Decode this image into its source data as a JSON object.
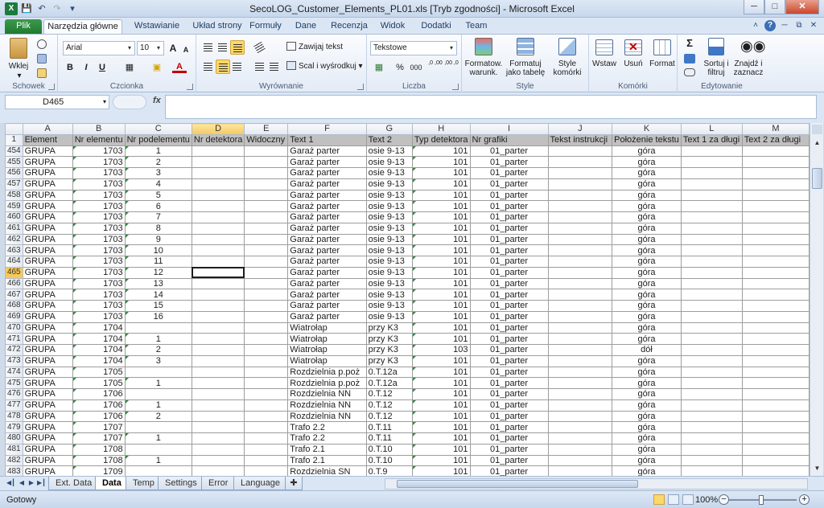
{
  "window": {
    "title": "SecoLOG_Customer_Elements_PL01.xls  [Tryb zgodności]  -  Microsoft Excel",
    "app_icon": "X",
    "quick_access": [
      "save-icon",
      "undo-icon",
      "redo-icon",
      "customize-icon"
    ],
    "controls": [
      "minimize-icon",
      "maximize-icon",
      "close-icon"
    ]
  },
  "ribbon_tabs": [
    "Plik",
    "Narzędzia główne",
    "Wstawianie",
    "Układ strony",
    "Formuły",
    "Dane",
    "Recenzja",
    "Widok",
    "Dodatki",
    "Team"
  ],
  "ribbon": {
    "clipboard": {
      "paste": "Wklej",
      "label": "Schowek"
    },
    "font": {
      "name": "Arial",
      "size": "10",
      "bold": "B",
      "italic": "I",
      "underline": "U",
      "grow": "A",
      "shrink": "A",
      "color": "A",
      "label": "Czcionka"
    },
    "alignment": {
      "wrap": "Zawijaj tekst",
      "merge": "Scal i wyśrodkuj",
      "label": "Wyrównanie"
    },
    "number": {
      "format": "Tekstowe",
      "percent": "%",
      "thousands": "000",
      "inc_dec": ",0 ,00",
      "dec_dec": ",00 ,0",
      "label": "Liczba"
    },
    "styles": {
      "conditional": "Formatow. warunk.",
      "as_table": "Formatuj jako tabelę",
      "cell_styles": "Style komórki",
      "label": "Style"
    },
    "cells": {
      "insert": "Wstaw",
      "delete": "Usuń",
      "format": "Format",
      "label": "Komórki"
    },
    "editing": {
      "sum": "Σ",
      "sort": "Sortuj i filtruj",
      "find": "Znajdź i zaznacz",
      "label": "Edytowanie"
    }
  },
  "formula_bar": {
    "name_box": "D465",
    "fx": "fx",
    "formula": ""
  },
  "grid": {
    "columns": [
      "A",
      "B",
      "C",
      "D",
      "E",
      "F",
      "G",
      "H",
      "I",
      "J",
      "K",
      "L",
      "M"
    ],
    "selected_column": "D",
    "header_row_number": "1",
    "headers": [
      "Element",
      "Nr elementu",
      "Nr podelementu",
      "Nr detektora",
      "Widoczny",
      "Text 1",
      "Text 2",
      "Typ detektora",
      "Nr grafiki",
      "Tekst instrukcji",
      "Położenie tekstu",
      "Text 1 za długi",
      "Text 2 za długi"
    ],
    "selected_row": "465",
    "rows": [
      {
        "num": "454",
        "cells": [
          "GRUPA",
          "1703",
          "1",
          "",
          "",
          "Garaż parter",
          "osie 9-13",
          "101",
          "01_parter",
          "",
          "góra",
          "",
          ""
        ]
      },
      {
        "num": "455",
        "cells": [
          "GRUPA",
          "1703",
          "2",
          "",
          "",
          "Garaż parter",
          "osie 9-13",
          "101",
          "01_parter",
          "",
          "góra",
          "",
          ""
        ]
      },
      {
        "num": "456",
        "cells": [
          "GRUPA",
          "1703",
          "3",
          "",
          "",
          "Garaż parter",
          "osie 9-13",
          "101",
          "01_parter",
          "",
          "góra",
          "",
          ""
        ]
      },
      {
        "num": "457",
        "cells": [
          "GRUPA",
          "1703",
          "4",
          "",
          "",
          "Garaż parter",
          "osie 9-13",
          "101",
          "01_parter",
          "",
          "góra",
          "",
          ""
        ]
      },
      {
        "num": "458",
        "cells": [
          "GRUPA",
          "1703",
          "5",
          "",
          "",
          "Garaż parter",
          "osie 9-13",
          "101",
          "01_parter",
          "",
          "góra",
          "",
          ""
        ]
      },
      {
        "num": "459",
        "cells": [
          "GRUPA",
          "1703",
          "6",
          "",
          "",
          "Garaż parter",
          "osie 9-13",
          "101",
          "01_parter",
          "",
          "góra",
          "",
          ""
        ]
      },
      {
        "num": "460",
        "cells": [
          "GRUPA",
          "1703",
          "7",
          "",
          "",
          "Garaż parter",
          "osie 9-13",
          "101",
          "01_parter",
          "",
          "góra",
          "",
          ""
        ]
      },
      {
        "num": "461",
        "cells": [
          "GRUPA",
          "1703",
          "8",
          "",
          "",
          "Garaż parter",
          "osie 9-13",
          "101",
          "01_parter",
          "",
          "góra",
          "",
          ""
        ]
      },
      {
        "num": "462",
        "cells": [
          "GRUPA",
          "1703",
          "9",
          "",
          "",
          "Garaż parter",
          "osie 9-13",
          "101",
          "01_parter",
          "",
          "góra",
          "",
          ""
        ]
      },
      {
        "num": "463",
        "cells": [
          "GRUPA",
          "1703",
          "10",
          "",
          "",
          "Garaż parter",
          "osie 9-13",
          "101",
          "01_parter",
          "",
          "góra",
          "",
          ""
        ]
      },
      {
        "num": "464",
        "cells": [
          "GRUPA",
          "1703",
          "11",
          "",
          "",
          "Garaż parter",
          "osie 9-13",
          "101",
          "01_parter",
          "",
          "góra",
          "",
          ""
        ]
      },
      {
        "num": "465",
        "cells": [
          "GRUPA",
          "1703",
          "12",
          "",
          "",
          "Garaż parter",
          "osie 9-13",
          "101",
          "01_parter",
          "",
          "góra",
          "",
          ""
        ]
      },
      {
        "num": "466",
        "cells": [
          "GRUPA",
          "1703",
          "13",
          "",
          "",
          "Garaż parter",
          "osie 9-13",
          "101",
          "01_parter",
          "",
          "góra",
          "",
          ""
        ]
      },
      {
        "num": "467",
        "cells": [
          "GRUPA",
          "1703",
          "14",
          "",
          "",
          "Garaż parter",
          "osie 9-13",
          "101",
          "01_parter",
          "",
          "góra",
          "",
          ""
        ]
      },
      {
        "num": "468",
        "cells": [
          "GRUPA",
          "1703",
          "15",
          "",
          "",
          "Garaż parter",
          "osie 9-13",
          "101",
          "01_parter",
          "",
          "góra",
          "",
          ""
        ]
      },
      {
        "num": "469",
        "cells": [
          "GRUPA",
          "1703",
          "16",
          "",
          "",
          "Garaż parter",
          "osie 9-13",
          "101",
          "01_parter",
          "",
          "góra",
          "",
          ""
        ]
      },
      {
        "num": "470",
        "cells": [
          "GRUPA",
          "1704",
          "",
          "",
          "",
          "Wiatrołap",
          "przy K3",
          "101",
          "01_parter",
          "",
          "góra",
          "",
          ""
        ]
      },
      {
        "num": "471",
        "cells": [
          "GRUPA",
          "1704",
          "1",
          "",
          "",
          "Wiatrołap",
          "przy K3",
          "101",
          "01_parter",
          "",
          "góra",
          "",
          ""
        ]
      },
      {
        "num": "472",
        "cells": [
          "GRUPA",
          "1704",
          "2",
          "",
          "",
          "Wiatrołap",
          "przy K3",
          "103",
          "01_parter",
          "",
          "dół",
          "",
          ""
        ]
      },
      {
        "num": "473",
        "cells": [
          "GRUPA",
          "1704",
          "3",
          "",
          "",
          "Wiatrołap",
          "przy K3",
          "101",
          "01_parter",
          "",
          "góra",
          "",
          ""
        ]
      },
      {
        "num": "474",
        "cells": [
          "GRUPA",
          "1705",
          "",
          "",
          "",
          "Rozdzielnia p.poż",
          "0.T.12a",
          "101",
          "01_parter",
          "",
          "góra",
          "",
          ""
        ]
      },
      {
        "num": "475",
        "cells": [
          "GRUPA",
          "1705",
          "1",
          "",
          "",
          "Rozdzielnia p.poż",
          "0.T.12a",
          "101",
          "01_parter",
          "",
          "góra",
          "",
          ""
        ]
      },
      {
        "num": "476",
        "cells": [
          "GRUPA",
          "1706",
          "",
          "",
          "",
          "Rozdzielnia NN",
          "0.T.12",
          "101",
          "01_parter",
          "",
          "góra",
          "",
          ""
        ]
      },
      {
        "num": "477",
        "cells": [
          "GRUPA",
          "1706",
          "1",
          "",
          "",
          "Rozdzielnia NN",
          "0.T.12",
          "101",
          "01_parter",
          "",
          "góra",
          "",
          ""
        ]
      },
      {
        "num": "478",
        "cells": [
          "GRUPA",
          "1706",
          "2",
          "",
          "",
          "Rozdzielnia NN",
          "0.T.12",
          "101",
          "01_parter",
          "",
          "góra",
          "",
          ""
        ]
      },
      {
        "num": "479",
        "cells": [
          "GRUPA",
          "1707",
          "",
          "",
          "",
          "Trafo 2.2",
          "0.T.11",
          "101",
          "01_parter",
          "",
          "góra",
          "",
          ""
        ]
      },
      {
        "num": "480",
        "cells": [
          "GRUPA",
          "1707",
          "1",
          "",
          "",
          "Trafo 2.2",
          "0.T.11",
          "101",
          "01_parter",
          "",
          "góra",
          "",
          ""
        ]
      },
      {
        "num": "481",
        "cells": [
          "GRUPA",
          "1708",
          "",
          "",
          "",
          "Trafo 2.1",
          "0.T.10",
          "101",
          "01_parter",
          "",
          "góra",
          "",
          ""
        ]
      },
      {
        "num": "482",
        "cells": [
          "GRUPA",
          "1708",
          "1",
          "",
          "",
          "Trafo 2.1",
          "0.T.10",
          "101",
          "01_parter",
          "",
          "góra",
          "",
          ""
        ]
      },
      {
        "num": "483",
        "cells": [
          "GRUPA",
          "1709",
          "",
          "",
          "",
          "Rozdzielnia SN",
          "0.T.9",
          "101",
          "01_parter",
          "",
          "góra",
          "",
          ""
        ]
      }
    ]
  },
  "sheets": [
    "Ext. Data",
    "Data",
    "Temp",
    "Settings",
    "Error",
    "Language"
  ],
  "active_sheet": "Data",
  "status": {
    "ready": "Gotowy",
    "zoom": "100%"
  },
  "colors": {
    "excel_green": "#1d7a3e",
    "selection_yellow": "#f5c95b",
    "ribbon_blue": "#dbe6f4"
  }
}
